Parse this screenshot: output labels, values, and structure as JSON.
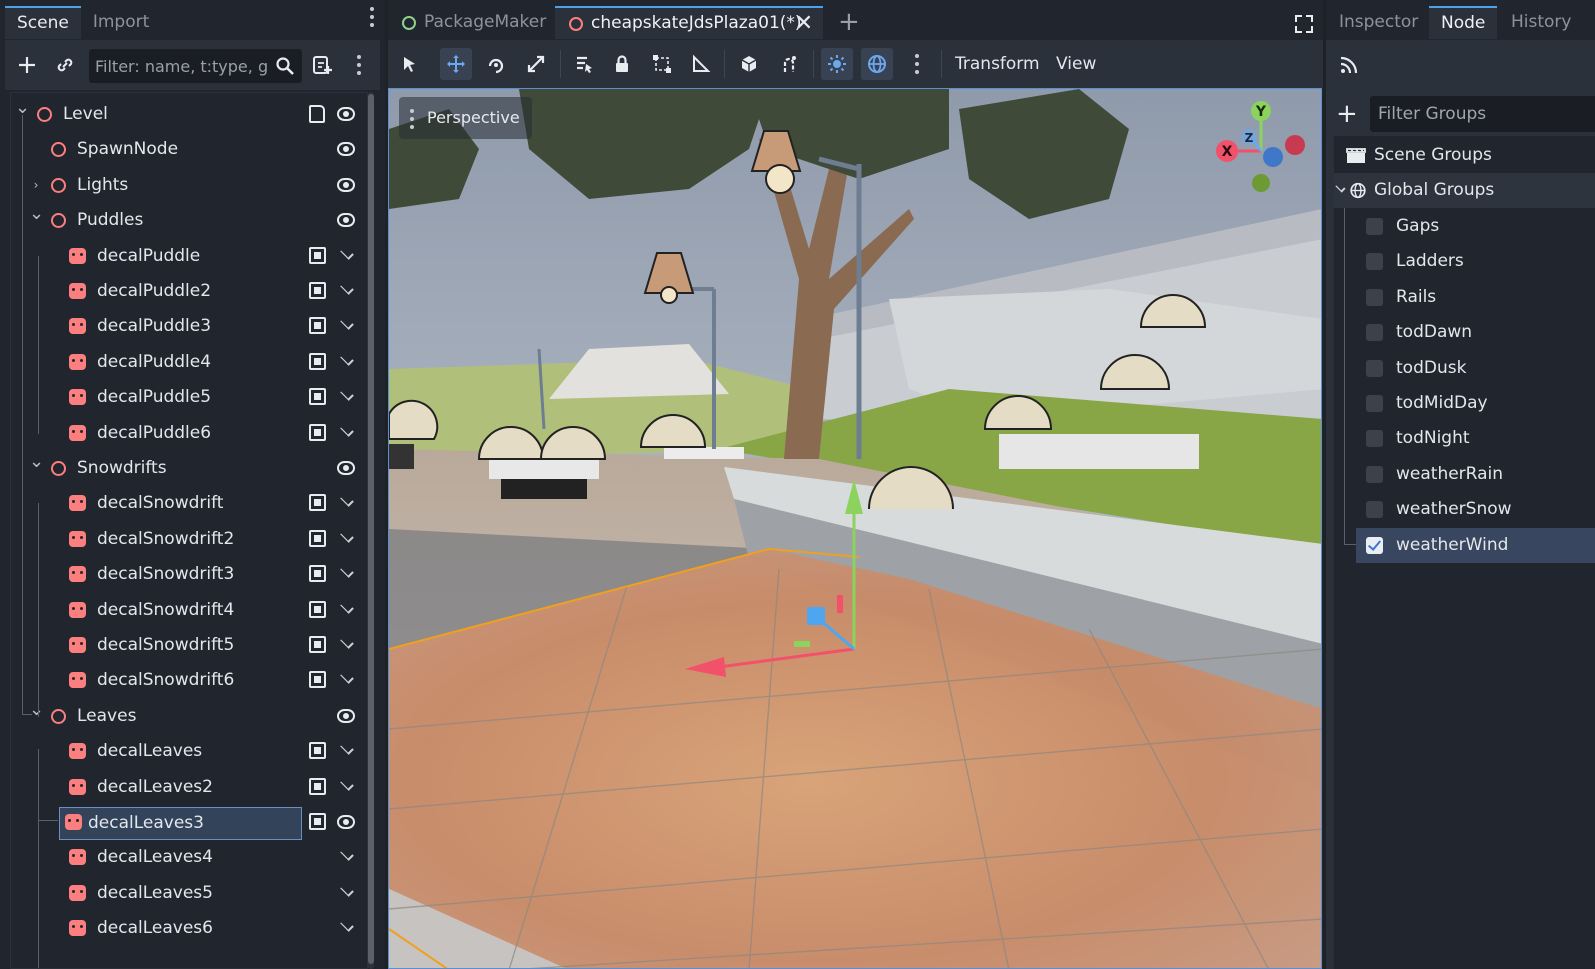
{
  "left_dock": {
    "tabs": [
      "Scene",
      "Import"
    ],
    "filter_placeholder": "Filter: name, t:type, g:"
  },
  "scene_tree": [
    {
      "label": "Level",
      "kind": "node3d",
      "expanded": true,
      "depth": 0,
      "r1": "script-icon",
      "r2": "eye-icon"
    },
    {
      "label": "SpawnNode",
      "kind": "node3d",
      "depth": 1,
      "r2": "eye-icon"
    },
    {
      "label": "Lights",
      "kind": "node3d",
      "expanded": false,
      "depth": 1,
      "r2": "eye-icon"
    },
    {
      "label": "Puddles",
      "kind": "node3d",
      "expanded": true,
      "depth": 1,
      "r2": "eye-icon"
    },
    {
      "label": "decalPuddle",
      "kind": "decal",
      "depth": 2,
      "r1": "box-icon",
      "r2": "chevron-down-icon"
    },
    {
      "label": "decalPuddle2",
      "kind": "decal",
      "depth": 2,
      "r1": "box-icon",
      "r2": "chevron-down-icon"
    },
    {
      "label": "decalPuddle3",
      "kind": "decal",
      "depth": 2,
      "r1": "box-icon",
      "r2": "chevron-down-icon"
    },
    {
      "label": "decalPuddle4",
      "kind": "decal",
      "depth": 2,
      "r1": "box-icon",
      "r2": "chevron-down-icon"
    },
    {
      "label": "decalPuddle5",
      "kind": "decal",
      "depth": 2,
      "r1": "box-icon",
      "r2": "chevron-down-icon"
    },
    {
      "label": "decalPuddle6",
      "kind": "decal",
      "depth": 2,
      "r1": "box-icon",
      "r2": "chevron-down-icon"
    },
    {
      "label": "Snowdrifts",
      "kind": "node3d",
      "expanded": true,
      "depth": 1,
      "r2": "eye-icon"
    },
    {
      "label": "decalSnowdrift",
      "kind": "decal",
      "depth": 2,
      "r1": "box-icon",
      "r2": "chevron-down-icon"
    },
    {
      "label": "decalSnowdrift2",
      "kind": "decal",
      "depth": 2,
      "r1": "box-icon",
      "r2": "chevron-down-icon"
    },
    {
      "label": "decalSnowdrift3",
      "kind": "decal",
      "depth": 2,
      "r1": "box-icon",
      "r2": "chevron-down-icon"
    },
    {
      "label": "decalSnowdrift4",
      "kind": "decal",
      "depth": 2,
      "r1": "box-icon",
      "r2": "chevron-down-icon"
    },
    {
      "label": "decalSnowdrift5",
      "kind": "decal",
      "depth": 2,
      "r1": "box-icon",
      "r2": "chevron-down-icon"
    },
    {
      "label": "decalSnowdrift6",
      "kind": "decal",
      "depth": 2,
      "r1": "box-icon",
      "r2": "chevron-down-icon"
    },
    {
      "label": "Leaves",
      "kind": "node3d",
      "expanded": true,
      "depth": 1,
      "r2": "eye-icon"
    },
    {
      "label": "decalLeaves",
      "kind": "decal",
      "depth": 2,
      "r1": "box-icon",
      "r2": "chevron-down-icon"
    },
    {
      "label": "decalLeaves2",
      "kind": "decal",
      "depth": 2,
      "r1": "box-icon",
      "r2": "chevron-down-icon"
    },
    {
      "label": "decalLeaves3",
      "kind": "decal",
      "depth": 2,
      "selected": true,
      "r1": "box-icon",
      "r2": "eye-icon"
    },
    {
      "label": "decalLeaves4",
      "kind": "decal",
      "depth": 2,
      "r2": "chevron-down-icon"
    },
    {
      "label": "decalLeaves5",
      "kind": "decal",
      "depth": 2,
      "r2": "chevron-down-icon"
    },
    {
      "label": "decalLeaves6",
      "kind": "decal",
      "depth": 2,
      "r2": "chevron-down-icon"
    }
  ],
  "scene_tabs": [
    {
      "label": "PackageMaker",
      "active": false
    },
    {
      "label": "cheapskateJdsPlaza01(*)",
      "active": true
    }
  ],
  "viewport_toolbar": {
    "menus": [
      "Transform",
      "View"
    ]
  },
  "viewport": {
    "mode_label": "Perspective",
    "gizmo_axes": [
      "Y",
      "X",
      "Z"
    ]
  },
  "right_dock": {
    "tabs": [
      "Inspector",
      "Node",
      "History"
    ],
    "filter_placeholder": "Filter Groups",
    "scene_groups_label": "Scene Groups",
    "global_groups_label": "Global Groups",
    "groups": [
      {
        "label": "Gaps",
        "checked": false
      },
      {
        "label": "Ladders",
        "checked": false
      },
      {
        "label": "Rails",
        "checked": false
      },
      {
        "label": "todDawn",
        "checked": false
      },
      {
        "label": "todDusk",
        "checked": false
      },
      {
        "label": "todMidDay",
        "checked": false
      },
      {
        "label": "todNight",
        "checked": false
      },
      {
        "label": "weatherRain",
        "checked": false
      },
      {
        "label": "weatherSnow",
        "checked": false
      },
      {
        "label": "weatherWind",
        "checked": true
      }
    ]
  },
  "colors": {
    "accent": "#4ea1e6",
    "node_icon": "#fc7f7f",
    "selection": "#32435a"
  }
}
